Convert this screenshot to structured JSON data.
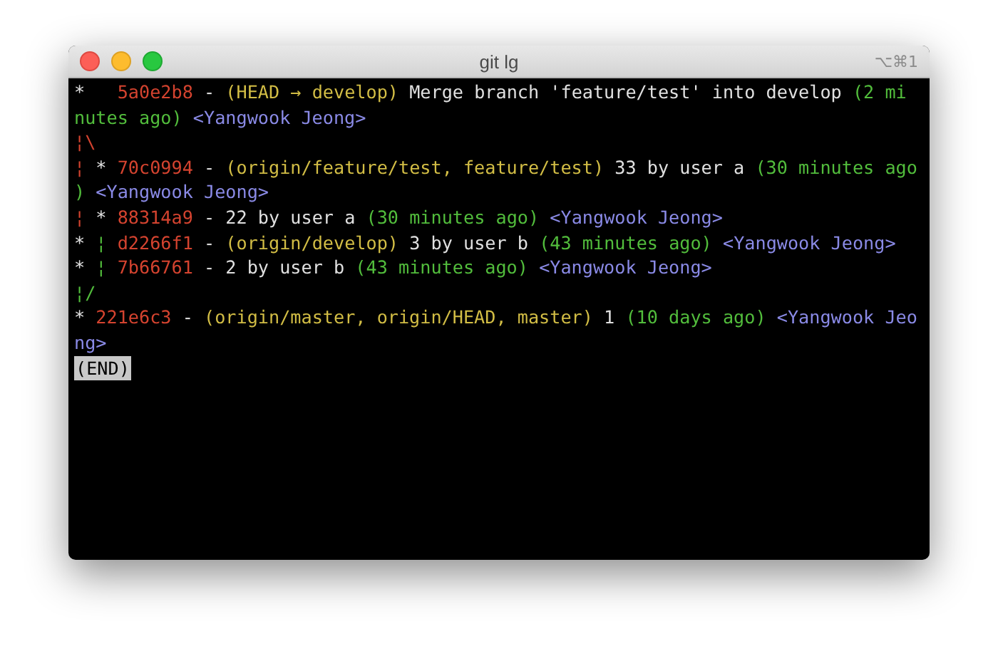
{
  "window": {
    "title": "git lg",
    "shortcut": "⌥⌘1"
  },
  "terminal": {
    "lines": [
      [
        {
          "text": "*   ",
          "color": "#e0e0e0"
        },
        {
          "text": "5a0e2b8",
          "color": "#d4432f"
        },
        {
          "text": " - ",
          "color": "#e0e0e0"
        },
        {
          "text": "(HEAD → develop)",
          "color": "#d2bd45"
        },
        {
          "text": " Merge branch 'feature/test' into develop ",
          "color": "#e0e0e0"
        },
        {
          "text": "(2 mi",
          "color": "#52bd3c"
        }
      ],
      [
        {
          "text": "nutes ago) ",
          "color": "#52bd3c"
        },
        {
          "text": "<Yangwook Jeong>",
          "color": "#8a8ae6"
        }
      ],
      [
        {
          "text": "¦\\",
          "color": "#d4432f"
        }
      ],
      [
        {
          "text": "¦",
          "color": "#d4432f"
        },
        {
          "text": " * ",
          "color": "#e0e0e0"
        },
        {
          "text": "70c0994",
          "color": "#d4432f"
        },
        {
          "text": " - ",
          "color": "#e0e0e0"
        },
        {
          "text": "(origin/feature/test, feature/test)",
          "color": "#d2bd45"
        },
        {
          "text": " 33 by user a ",
          "color": "#e0e0e0"
        },
        {
          "text": "(30 minutes ago",
          "color": "#52bd3c"
        }
      ],
      [
        {
          "text": ") ",
          "color": "#52bd3c"
        },
        {
          "text": "<Yangwook Jeong>",
          "color": "#8a8ae6"
        }
      ],
      [
        {
          "text": "¦",
          "color": "#d4432f"
        },
        {
          "text": " * ",
          "color": "#e0e0e0"
        },
        {
          "text": "88314a9",
          "color": "#d4432f"
        },
        {
          "text": " - 22 by user a ",
          "color": "#e0e0e0"
        },
        {
          "text": "(30 minutes ago) ",
          "color": "#52bd3c"
        },
        {
          "text": "<Yangwook Jeong>",
          "color": "#8a8ae6"
        }
      ],
      [
        {
          "text": "* ",
          "color": "#e0e0e0"
        },
        {
          "text": "¦ ",
          "color": "#52bd3c"
        },
        {
          "text": "d2266f1",
          "color": "#d4432f"
        },
        {
          "text": " - ",
          "color": "#e0e0e0"
        },
        {
          "text": "(origin/develop)",
          "color": "#d2bd45"
        },
        {
          "text": " 3 by user b ",
          "color": "#e0e0e0"
        },
        {
          "text": "(43 minutes ago) ",
          "color": "#52bd3c"
        },
        {
          "text": "<Yangwook Jeong>",
          "color": "#8a8ae6"
        }
      ],
      [
        {
          "text": "* ",
          "color": "#e0e0e0"
        },
        {
          "text": "¦ ",
          "color": "#52bd3c"
        },
        {
          "text": "7b66761",
          "color": "#d4432f"
        },
        {
          "text": " - 2 by user b ",
          "color": "#e0e0e0"
        },
        {
          "text": "(43 minutes ago) ",
          "color": "#52bd3c"
        },
        {
          "text": "<Yangwook Jeong>",
          "color": "#8a8ae6"
        }
      ],
      [
        {
          "text": "¦/",
          "color": "#52bd3c"
        }
      ],
      [
        {
          "text": "* ",
          "color": "#e0e0e0"
        },
        {
          "text": "221e6c3",
          "color": "#d4432f"
        },
        {
          "text": " - ",
          "color": "#e0e0e0"
        },
        {
          "text": "(origin/master, origin/HEAD, master)",
          "color": "#d2bd45"
        },
        {
          "text": " 1 ",
          "color": "#e0e0e0"
        },
        {
          "text": "(10 days ago) ",
          "color": "#52bd3c"
        },
        {
          "text": "<Yangwook Jeo",
          "color": "#8a8ae6"
        }
      ],
      [
        {
          "text": "ng>",
          "color": "#8a8ae6"
        }
      ]
    ],
    "pager_status": "(END)"
  }
}
